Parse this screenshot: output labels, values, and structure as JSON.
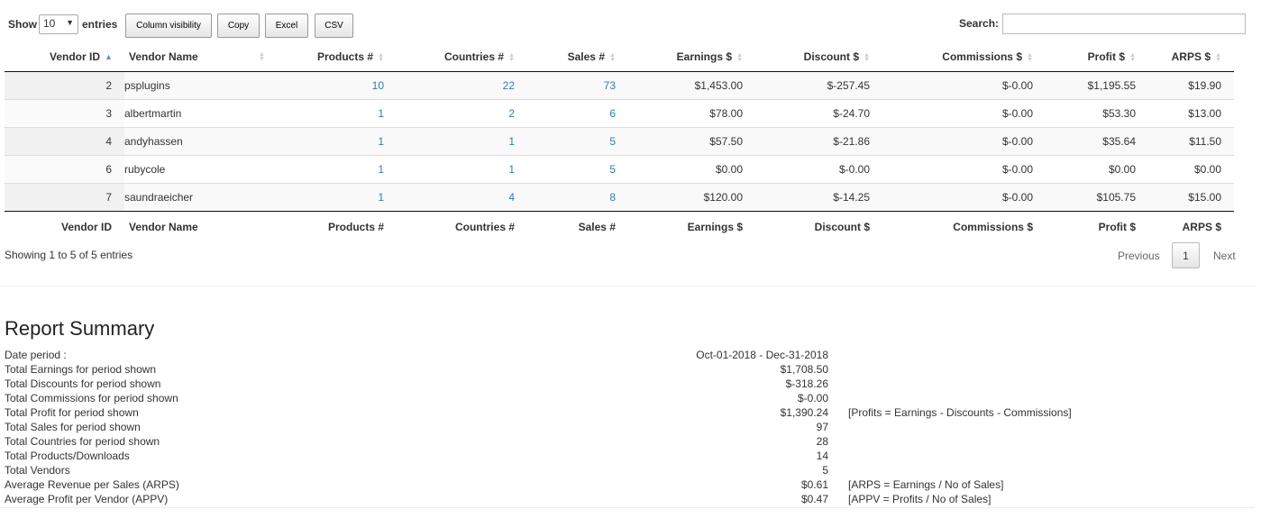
{
  "toolbar": {
    "show_label": "Show",
    "length_value": "10",
    "entries_label": "entries",
    "buttons": [
      "Column visibility",
      "Copy",
      "Excel",
      "CSV"
    ],
    "search_label": "Search:",
    "search_value": ""
  },
  "table": {
    "columns": [
      "Vendor ID",
      "Vendor Name",
      "Products #",
      "Countries #",
      "Sales #",
      "Earnings $",
      "Discount $",
      "Commissions $",
      "Profit $",
      "ARPS $"
    ],
    "rows": [
      [
        "2",
        "psplugins",
        "10",
        "22",
        "73",
        "$1,453.00",
        "$-257.45",
        "$-0.00",
        "$1,195.55",
        "$19.90"
      ],
      [
        "3",
        "albertmartin",
        "1",
        "2",
        "6",
        "$78.00",
        "$-24.70",
        "$-0.00",
        "$53.30",
        "$13.00"
      ],
      [
        "4",
        "andyhassen",
        "1",
        "1",
        "5",
        "$57.50",
        "$-21.86",
        "$-0.00",
        "$35.64",
        "$11.50"
      ],
      [
        "6",
        "rubycole",
        "1",
        "1",
        "5",
        "$0.00",
        "$-0.00",
        "$-0.00",
        "$0.00",
        "$0.00"
      ],
      [
        "7",
        "saundraeicher",
        "1",
        "4",
        "8",
        "$120.00",
        "$-14.25",
        "$-0.00",
        "$105.75",
        "$15.00"
      ]
    ]
  },
  "pagination": {
    "info": "Showing 1 to 5 of 5 entries",
    "previous": "Previous",
    "current_page": "1",
    "next": "Next"
  },
  "summary": {
    "title": "Report Summary",
    "rows": [
      {
        "label": "Date period :",
        "value": "Oct-01-2018 - Dec-31-2018",
        "note": ""
      },
      {
        "label": "Total Earnings for period shown",
        "value": "$1,708.50",
        "note": ""
      },
      {
        "label": "Total Discounts for period shown",
        "value": "$-318.26",
        "note": ""
      },
      {
        "label": "Total Commissions for period shown",
        "value": "$-0.00",
        "note": ""
      },
      {
        "label": "Total Profit for period shown",
        "value": "$1,390.24",
        "note": "[Profits = Earnings - Discounts - Commissions]"
      },
      {
        "label": "Total Sales for period shown",
        "value": "97",
        "note": ""
      },
      {
        "label": "Total Countries for period shown",
        "value": "28",
        "note": ""
      },
      {
        "label": "Total Products/Downloads",
        "value": "14",
        "note": ""
      },
      {
        "label": "Total Vendors",
        "value": "5",
        "note": ""
      },
      {
        "label": "Average Revenue per Sales (ARPS)",
        "value": "$0.61",
        "note": "[ARPS = Earnings / No of Sales]"
      },
      {
        "label": "Average Profit per Vendor (APPV)",
        "value": "$0.47",
        "note": "[APPV = Profits / No of Sales]"
      }
    ]
  },
  "colors": {
    "link": "#337ab7",
    "sort_active": "#6b8fd6"
  }
}
